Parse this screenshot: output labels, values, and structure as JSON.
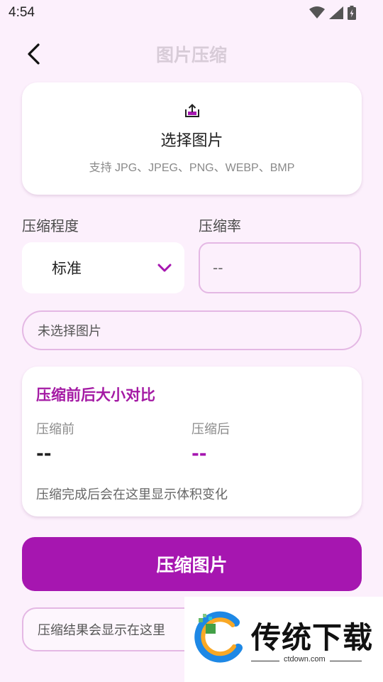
{
  "status_bar": {
    "time": "4:54"
  },
  "header": {
    "title": "图片压缩"
  },
  "upload": {
    "title": "选择图片",
    "hint": "支持 JPG、JPEG、PNG、WEBP、BMP"
  },
  "settings": {
    "level_label": "压缩程度",
    "level_value": "标准",
    "ratio_label": "压缩率",
    "ratio_value": "--"
  },
  "file_status": "未选择图片",
  "compare": {
    "title": "压缩前后大小对比",
    "before_label": "压缩前",
    "before_value": "--",
    "after_label": "压缩后",
    "after_value": "--",
    "note": "压缩完成后会在这里显示体积变化"
  },
  "compress_button": "压缩图片",
  "result_text": "压缩结果会显示在这里",
  "watermark": {
    "brand": "传统下载",
    "domain": "ctdown.com"
  },
  "colors": {
    "accent": "#a616b0",
    "border": "#e4b8e4",
    "background": "#fcf0fc",
    "title_muted": "#d8ccd8"
  }
}
